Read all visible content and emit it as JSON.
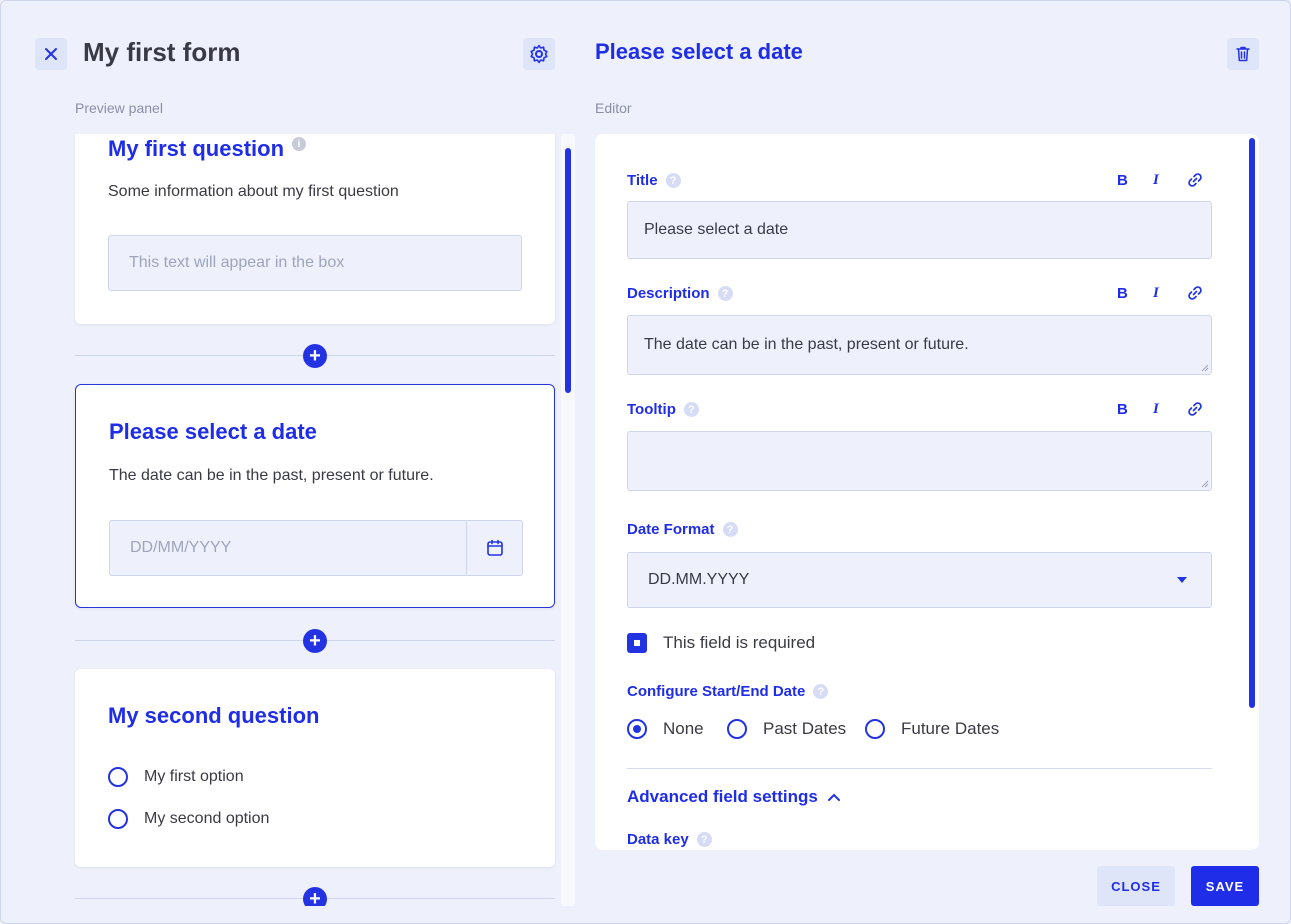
{
  "header": {
    "form_title": "My first form",
    "editor_title": "Please select a date",
    "preview_label": "Preview panel",
    "editor_label": "Editor"
  },
  "preview": {
    "card1": {
      "title": "My first question",
      "description": "Some information about my first question",
      "placeholder": "This text will appear in the box"
    },
    "card2": {
      "title": "Please select a date",
      "description": "The date can be in the past, present or future.",
      "placeholder": "DD/MM/YYYY"
    },
    "card3": {
      "title": "My second question",
      "options": [
        "My first option",
        "My second option"
      ]
    },
    "scroll_fraction": 0.33
  },
  "editor": {
    "title_label": "Title",
    "title_value": "Please select a date",
    "description_label": "Description",
    "description_value": "The date can be in the past, present or future.",
    "tooltip_label": "Tooltip",
    "tooltip_value": "",
    "date_format_label": "Date Format",
    "date_format_value": "DD.MM.YYYY",
    "required_label": "This field is required",
    "required_checked": true,
    "start_end_label": "Configure Start/End Date",
    "start_end_options": [
      "None",
      "Past Dates",
      "Future Dates"
    ],
    "start_end_selected": "None",
    "advanced_label": "Advanced field settings",
    "data_key_label": "Data key",
    "format_buttons": [
      "B",
      "I"
    ],
    "help_glyph": "?"
  },
  "footer": {
    "close_label": "CLOSE",
    "save_label": "SAVE"
  },
  "colors": {
    "accent": "#2333e2",
    "background": "#eef1fb",
    "button_secondary": "#dfe5f8"
  }
}
